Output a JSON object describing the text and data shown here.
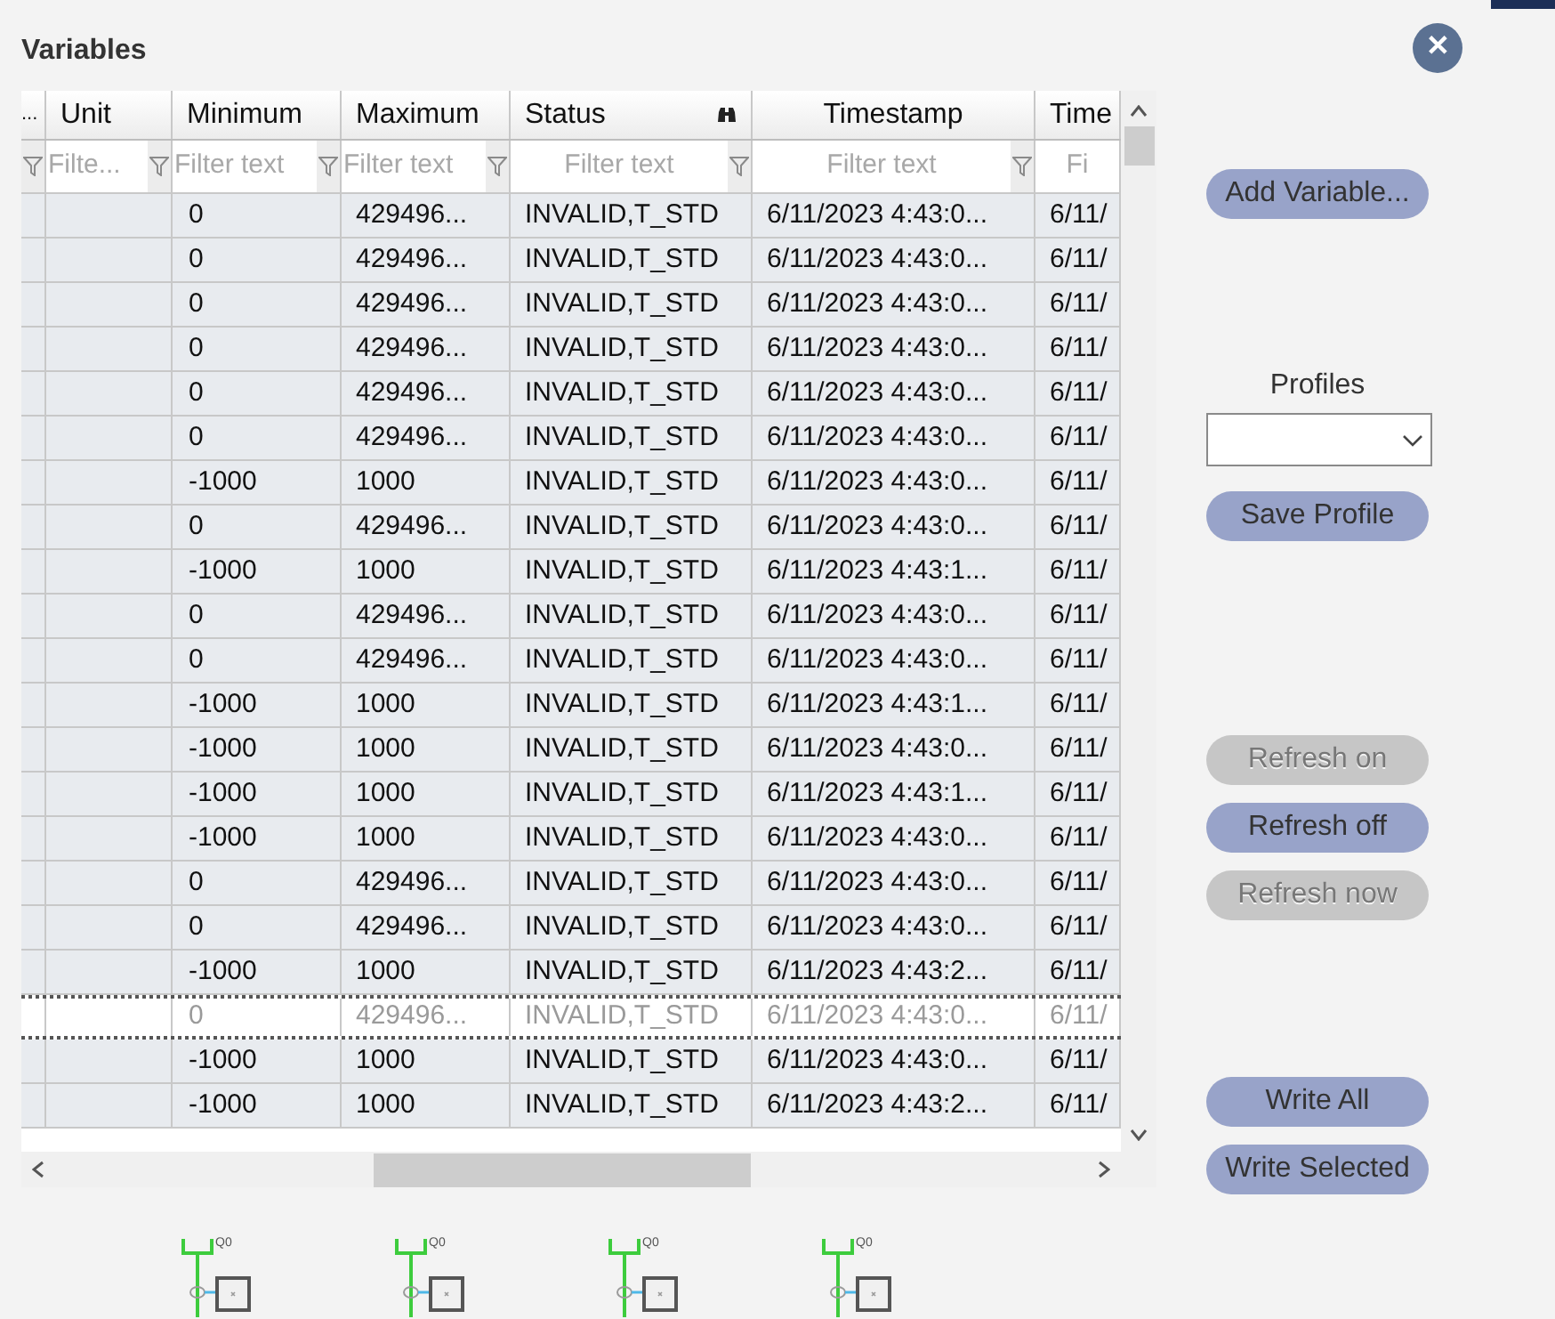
{
  "title": "Variables",
  "close_button": {
    "label": "✕"
  },
  "table": {
    "columns": [
      {
        "label": "..."
      },
      {
        "label": "Unit",
        "filter": "Filte..."
      },
      {
        "label": "Minimum",
        "filter": "Filter text"
      },
      {
        "label": "Maximum",
        "filter": "Filter text"
      },
      {
        "label": "Status",
        "filter": "Filter text"
      },
      {
        "label": "Timestamp",
        "filter": "Filter text"
      },
      {
        "label": "Time",
        "filter": "Fi"
      }
    ],
    "rows": [
      {
        "selected": false,
        "minimum": "0",
        "maximum": "429496...",
        "status": "INVALID,T_STD",
        "timestamp": "6/11/2023 4:43:0...",
        "column_7": "6/11/"
      },
      {
        "selected": false,
        "minimum": "0",
        "maximum": "429496...",
        "status": "INVALID,T_STD",
        "timestamp": "6/11/2023 4:43:0...",
        "column_7": "6/11/"
      },
      {
        "selected": false,
        "minimum": "0",
        "maximum": "429496...",
        "status": "INVALID,T_STD",
        "timestamp": "6/11/2023 4:43:0...",
        "column_7": "6/11/"
      },
      {
        "selected": false,
        "minimum": "0",
        "maximum": "429496...",
        "status": "INVALID,T_STD",
        "timestamp": "6/11/2023 4:43:0...",
        "column_7": "6/11/"
      },
      {
        "selected": false,
        "minimum": "0",
        "maximum": "429496...",
        "status": "INVALID,T_STD",
        "timestamp": "6/11/2023 4:43:0...",
        "column_7": "6/11/"
      },
      {
        "selected": false,
        "minimum": "0",
        "maximum": "429496...",
        "status": "INVALID,T_STD",
        "timestamp": "6/11/2023 4:43:0...",
        "column_7": "6/11/"
      },
      {
        "selected": false,
        "minimum": "-1000",
        "maximum": "1000",
        "status": "INVALID,T_STD",
        "timestamp": "6/11/2023 4:43:0...",
        "column_7": "6/11/"
      },
      {
        "selected": false,
        "minimum": "0",
        "maximum": "429496...",
        "status": "INVALID,T_STD",
        "timestamp": "6/11/2023 4:43:0...",
        "column_7": "6/11/"
      },
      {
        "selected": false,
        "minimum": "-1000",
        "maximum": "1000",
        "status": "INVALID,T_STD",
        "timestamp": "6/11/2023 4:43:1...",
        "column_7": "6/11/"
      },
      {
        "selected": false,
        "minimum": "0",
        "maximum": "429496...",
        "status": "INVALID,T_STD",
        "timestamp": "6/11/2023 4:43:0...",
        "column_7": "6/11/"
      },
      {
        "selected": false,
        "minimum": "0",
        "maximum": "429496...",
        "status": "INVALID,T_STD",
        "timestamp": "6/11/2023 4:43:0...",
        "column_7": "6/11/"
      },
      {
        "selected": false,
        "minimum": "-1000",
        "maximum": "1000",
        "status": "INVALID,T_STD",
        "timestamp": "6/11/2023 4:43:1...",
        "column_7": "6/11/"
      },
      {
        "selected": false,
        "minimum": "-1000",
        "maximum": "1000",
        "status": "INVALID,T_STD",
        "timestamp": "6/11/2023 4:43:0...",
        "column_7": "6/11/"
      },
      {
        "selected": false,
        "minimum": "-1000",
        "maximum": "1000",
        "status": "INVALID,T_STD",
        "timestamp": "6/11/2023 4:43:1...",
        "column_7": "6/11/"
      },
      {
        "selected": false,
        "minimum": "-1000",
        "maximum": "1000",
        "status": "INVALID,T_STD",
        "timestamp": "6/11/2023 4:43:0...",
        "column_7": "6/11/"
      },
      {
        "selected": false,
        "minimum": "0",
        "maximum": "429496...",
        "status": "INVALID,T_STD",
        "timestamp": "6/11/2023 4:43:0...",
        "column_7": "6/11/"
      },
      {
        "selected": false,
        "minimum": "0",
        "maximum": "429496...",
        "status": "INVALID,T_STD",
        "timestamp": "6/11/2023 4:43:0...",
        "column_7": "6/11/"
      },
      {
        "selected": false,
        "minimum": "-1000",
        "maximum": "1000",
        "status": "INVALID,T_STD",
        "timestamp": "6/11/2023 4:43:2...",
        "column_7": "6/11/"
      },
      {
        "selected": true,
        "minimum": "0",
        "maximum": "429496...",
        "status": "INVALID,T_STD",
        "timestamp": "6/11/2023 4:43:0...",
        "column_7": "6/11/"
      },
      {
        "selected": false,
        "minimum": "-1000",
        "maximum": "1000",
        "status": "INVALID,T_STD",
        "timestamp": "6/11/2023 4:43:0...",
        "column_7": "6/11/"
      },
      {
        "selected": false,
        "minimum": "-1000",
        "maximum": "1000",
        "status": "INVALID,T_STD",
        "timestamp": "6/11/2023 4:43:2...",
        "column_7": "6/11/"
      }
    ]
  },
  "actions": [
    {
      "label": "Add Variable...",
      "disabled": false
    }
  ],
  "profiles": {
    "label": "Profiles"
  },
  "profile_actions": [
    {
      "label": "Save Profile",
      "disabled": false
    }
  ],
  "refresh_actions": [
    {
      "label": "Refresh on",
      "disabled": true
    },
    {
      "label": "Refresh off",
      "disabled": false
    },
    {
      "label": "Refresh now",
      "disabled": true
    }
  ],
  "write_actions": [
    {
      "label": "Write All",
      "disabled": false
    },
    {
      "label": "Write Selected",
      "disabled": false
    }
  ],
  "symbols": [
    {
      "label": "Q0"
    },
    {
      "label": "Q0"
    },
    {
      "label": "Q0"
    },
    {
      "label": "Q0"
    }
  ]
}
